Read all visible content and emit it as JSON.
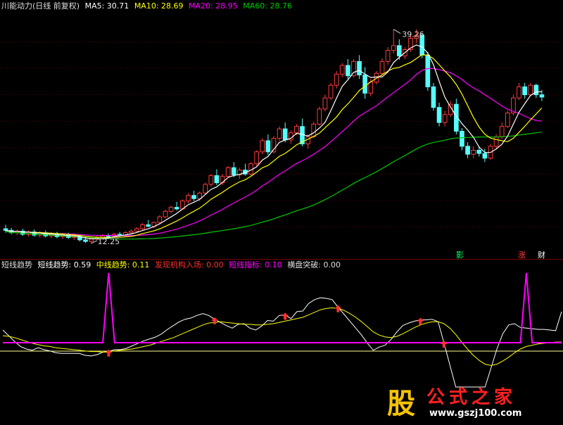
{
  "main_header": {
    "title": "川能动力(日线 前复权)",
    "ma5_label": "MA5: 30.71",
    "ma10_label": "MA10: 28.69",
    "ma20_label": "MA20: 28.95",
    "ma60_label": "MA60: 28.76"
  },
  "badges": {
    "b1": "影",
    "b2": "涨",
    "b3": "财"
  },
  "indicator_header": {
    "name": "短线趋势",
    "short_trend": "短线趋势: 0.59",
    "mid_trend": "中线趋势: 0.11",
    "inst_entry": "发现机构入场: 0.00",
    "short_index": "短线指标: 0.10",
    "breakout": "横盘突破: 0.00"
  },
  "logo": {
    "glyph": "股",
    "title": "公式之家",
    "url": "www.gszj100.com"
  },
  "colors": {
    "up": "#ff3c3c",
    "down": "#54ffff",
    "ma5": "#ffffff",
    "ma10": "#ffff00",
    "ma20": "#ff00ff",
    "ma60": "#00c800",
    "divider": "#7a0000"
  },
  "chart_data": [
    {
      "type": "candlestick",
      "title": "川能动力(日线 前复权)",
      "annotations": [
        {
          "text": "39.26",
          "series": "high"
        },
        {
          "text": "12.25",
          "series": "low"
        }
      ],
      "ylim": [
        11,
        41
      ],
      "candles": [
        [
          14.1,
          14.6,
          13.6,
          13.9
        ],
        [
          13.9,
          14.2,
          13.4,
          13.6
        ],
        [
          13.6,
          14.0,
          13.3,
          13.8
        ],
        [
          13.8,
          14.1,
          13.2,
          13.4
        ],
        [
          13.4,
          13.9,
          13.1,
          13.7
        ],
        [
          13.7,
          14.0,
          13.1,
          13.3
        ],
        [
          13.3,
          13.8,
          13.0,
          13.6
        ],
        [
          13.6,
          13.9,
          13.0,
          13.2
        ],
        [
          13.2,
          13.6,
          12.9,
          13.4
        ],
        [
          13.4,
          13.7,
          12.9,
          13.1
        ],
        [
          13.1,
          13.5,
          12.8,
          13.3
        ],
        [
          13.3,
          13.6,
          12.8,
          13.0
        ],
        [
          13.0,
          13.4,
          12.7,
          13.2
        ],
        [
          13.2,
          13.4,
          12.5,
          12.7
        ],
        [
          12.7,
          13.1,
          12.3,
          12.5
        ],
        [
          12.5,
          12.9,
          12.25,
          12.8
        ],
        [
          12.8,
          13.2,
          12.6,
          13.0
        ],
        [
          13.0,
          13.4,
          12.8,
          13.2
        ],
        [
          13.2,
          13.5,
          12.9,
          13.1
        ],
        [
          13.1,
          13.6,
          12.9,
          13.4
        ],
        [
          13.4,
          13.7,
          13.1,
          13.3
        ],
        [
          13.3,
          13.8,
          13.1,
          13.6
        ],
        [
          13.6,
          14.0,
          13.4,
          13.8
        ],
        [
          13.8,
          14.3,
          13.6,
          14.1
        ],
        [
          14.1,
          14.8,
          13.9,
          14.6
        ],
        [
          14.6,
          15.2,
          14.3,
          14.4
        ],
        [
          14.4,
          15.0,
          14.2,
          14.9
        ],
        [
          14.9,
          15.8,
          14.7,
          15.6
        ],
        [
          15.6,
          16.5,
          15.4,
          16.3
        ],
        [
          16.3,
          17.0,
          16.0,
          16.8
        ],
        [
          16.8,
          17.5,
          16.4,
          16.6
        ],
        [
          16.6,
          17.8,
          16.5,
          17.6
        ],
        [
          17.6,
          18.6,
          17.3,
          18.3
        ],
        [
          18.3,
          18.9,
          17.6,
          17.9
        ],
        [
          17.9,
          18.8,
          17.6,
          18.6
        ],
        [
          18.6,
          19.9,
          18.4,
          19.7
        ],
        [
          19.7,
          21.0,
          19.4,
          20.8
        ],
        [
          20.8,
          21.6,
          19.6,
          19.9
        ],
        [
          19.9,
          21.0,
          19.6,
          20.7
        ],
        [
          20.7,
          22.0,
          20.5,
          21.8
        ],
        [
          21.8,
          22.5,
          20.6,
          20.9
        ],
        [
          20.9,
          21.8,
          20.4,
          21.5
        ],
        [
          21.5,
          22.3,
          20.8,
          21.0
        ],
        [
          21.0,
          22.5,
          20.8,
          22.3
        ],
        [
          22.3,
          24.0,
          22.0,
          23.8
        ],
        [
          23.8,
          25.5,
          23.5,
          25.2
        ],
        [
          25.2,
          26.0,
          23.4,
          23.8
        ],
        [
          23.8,
          25.8,
          23.6,
          25.5
        ],
        [
          25.5,
          27.0,
          25.2,
          26.7
        ],
        [
          26.7,
          27.5,
          25.0,
          25.3
        ],
        [
          25.3,
          26.5,
          24.8,
          26.2
        ],
        [
          26.2,
          27.3,
          25.9,
          27.0
        ],
        [
          27.0,
          28.0,
          24.5,
          24.8
        ],
        [
          24.8,
          26.0,
          24.2,
          25.7
        ],
        [
          25.7,
          27.6,
          25.5,
          27.3
        ],
        [
          27.3,
          29.5,
          27.1,
          29.2
        ],
        [
          29.2,
          31.0,
          28.9,
          30.6
        ],
        [
          30.6,
          32.5,
          30.3,
          32.2
        ],
        [
          32.2,
          34.0,
          31.8,
          33.6
        ],
        [
          33.6,
          35.0,
          33.2,
          34.7
        ],
        [
          34.7,
          35.5,
          33.0,
          33.4
        ],
        [
          33.4,
          35.5,
          33.2,
          35.2
        ],
        [
          35.2,
          36.0,
          33.0,
          33.5
        ],
        [
          33.5,
          34.5,
          30.5,
          31.2
        ],
        [
          31.2,
          33.0,
          30.8,
          32.6
        ],
        [
          32.6,
          34.0,
          32.3,
          33.7
        ],
        [
          33.7,
          35.6,
          33.4,
          35.2
        ],
        [
          35.2,
          37.0,
          34.8,
          36.6
        ],
        [
          36.6,
          39.26,
          36.2,
          37.2
        ],
        [
          37.2,
          38.0,
          35.4,
          35.9
        ],
        [
          35.9,
          37.0,
          35.5,
          36.7
        ],
        [
          36.7,
          38.5,
          36.4,
          38.1
        ],
        [
          38.1,
          39.26,
          37.5,
          38.5
        ],
        [
          38.5,
          38.8,
          35.6,
          36.0
        ],
        [
          36.0,
          36.4,
          31.5,
          32.0
        ],
        [
          32.0,
          32.5,
          29.0,
          29.4
        ],
        [
          29.4,
          30.0,
          27.0,
          27.5
        ],
        [
          27.5,
          29.0,
          27.0,
          28.5
        ],
        [
          28.5,
          30.2,
          28.2,
          29.8
        ],
        [
          29.8,
          30.5,
          26.0,
          26.4
        ],
        [
          26.4,
          26.8,
          24.0,
          24.5
        ],
        [
          24.5,
          25.0,
          23.0,
          23.5
        ],
        [
          23.5,
          24.5,
          23.0,
          24.0
        ],
        [
          24.0,
          24.5,
          23.2,
          23.6
        ],
        [
          23.6,
          24.2,
          22.5,
          23.0
        ],
        [
          23.0,
          24.8,
          22.8,
          24.5
        ],
        [
          24.5,
          26.0,
          24.2,
          25.7
        ],
        [
          25.7,
          27.5,
          25.4,
          27.0
        ],
        [
          27.0,
          29.0,
          26.8,
          28.7
        ],
        [
          28.7,
          31.0,
          28.4,
          30.6
        ],
        [
          30.6,
          32.5,
          30.3,
          32.0
        ],
        [
          32.0,
          32.5,
          30.5,
          31.0
        ],
        [
          31.0,
          32.5,
          30.8,
          32.2
        ],
        [
          32.2,
          32.4,
          30.6,
          31.0
        ],
        [
          31.0,
          31.6,
          30.2,
          30.71
        ]
      ]
    },
    {
      "type": "line",
      "title": "短线趋势",
      "ylim": [
        -0.6,
        1.2
      ],
      "series": [
        {
          "name": "短线趋势",
          "values": [
            0.3,
            0.21,
            0.12,
            0.04,
            0.0,
            -0.02,
            0.02,
            -0.01,
            -0.03,
            -0.06,
            -0.07,
            -0.07,
            -0.07,
            -0.07,
            -0.1,
            -0.11,
            -0.09,
            -0.05,
            -0.04,
            -0.01,
            -0.01,
            0.01,
            0.05,
            0.09,
            0.13,
            0.16,
            0.19,
            0.24,
            0.31,
            0.37,
            0.43,
            0.47,
            0.49,
            0.53,
            0.56,
            0.53,
            0.47,
            0.42,
            0.37,
            0.33,
            0.39,
            0.4,
            0.33,
            0.3,
            0.36,
            0.45,
            0.44,
            0.53,
            0.54,
            0.48,
            0.59,
            0.6,
            0.72,
            0.78,
            0.81,
            0.8,
            0.78,
            0.66,
            0.55,
            0.44,
            0.33,
            0.22,
            0.09,
            -0.02,
            0.03,
            0.06,
            0.15,
            0.27,
            0.37,
            0.41,
            0.44,
            0.46,
            0.46,
            0.47,
            0.43,
            0.1,
            -0.25,
            -0.6,
            -0.6,
            -0.6,
            -0.6,
            -0.6,
            -0.6,
            -0.3,
            0.0,
            0.24,
            0.38,
            0.4,
            0.34,
            0.33,
            0.32,
            0.31,
            0.31,
            0.3,
            0.29,
            0.59
          ]
        },
        {
          "name": "中线趋势",
          "values": [
            0.21,
            0.2,
            0.18,
            0.15,
            0.12,
            0.09,
            0.07,
            0.05,
            0.04,
            0.02,
            0.01,
            0.0,
            -0.01,
            -0.02,
            -0.03,
            -0.04,
            -0.04,
            -0.05,
            -0.04,
            -0.03,
            -0.02,
            -0.01,
            0.0,
            0.02,
            0.04,
            0.06,
            0.09,
            0.12,
            0.15,
            0.18,
            0.22,
            0.26,
            0.3,
            0.34,
            0.38,
            0.41,
            0.42,
            0.43,
            0.42,
            0.41,
            0.4,
            0.39,
            0.39,
            0.38,
            0.38,
            0.39,
            0.4,
            0.42,
            0.44,
            0.46,
            0.48,
            0.5,
            0.54,
            0.58,
            0.62,
            0.64,
            0.65,
            0.64,
            0.61,
            0.56,
            0.5,
            0.43,
            0.35,
            0.27,
            0.22,
            0.19,
            0.18,
            0.2,
            0.24,
            0.29,
            0.34,
            0.38,
            0.41,
            0.43,
            0.43,
            0.4,
            0.33,
            0.23,
            0.11,
            0.0,
            -0.1,
            -0.18,
            -0.24,
            -0.26,
            -0.24,
            -0.19,
            -0.13,
            -0.06,
            0.0,
            0.04,
            0.06,
            0.08,
            0.09,
            0.1,
            0.11,
            0.11
          ]
        },
        {
          "name": "短线指标",
          "values": [
            0.1,
            0.1,
            0.1,
            0.1,
            0.1,
            0.1,
            0.1,
            0.1,
            0.1,
            0.1,
            0.1,
            0.1,
            0.1,
            0.1,
            0.1,
            0.1,
            0.1,
            0.1,
            1.2,
            0.1,
            0.1,
            0.1,
            0.1,
            0.1,
            0.1,
            0.1,
            0.1,
            0.1,
            0.1,
            0.1,
            0.1,
            0.1,
            0.1,
            0.1,
            0.1,
            0.1,
            0.1,
            0.1,
            0.1,
            0.1,
            0.1,
            0.1,
            0.1,
            0.1,
            0.1,
            0.1,
            0.1,
            0.1,
            0.1,
            0.1,
            0.1,
            0.1,
            0.1,
            0.1,
            0.1,
            0.1,
            0.1,
            0.1,
            0.1,
            0.1,
            0.1,
            0.1,
            0.1,
            0.1,
            0.1,
            0.1,
            0.1,
            0.1,
            0.1,
            0.1,
            0.1,
            0.1,
            0.1,
            0.1,
            0.1,
            0.1,
            0.1,
            0.1,
            0.1,
            0.1,
            0.1,
            0.1,
            0.1,
            0.1,
            0.1,
            0.1,
            0.1,
            0.1,
            0.1,
            1.2,
            0.1,
            0.1,
            0.1,
            0.1,
            0.1,
            0.1
          ]
        }
      ],
      "signals": [
        18,
        36,
        48,
        57,
        71,
        75
      ],
      "baseline": 0.0
    }
  ]
}
